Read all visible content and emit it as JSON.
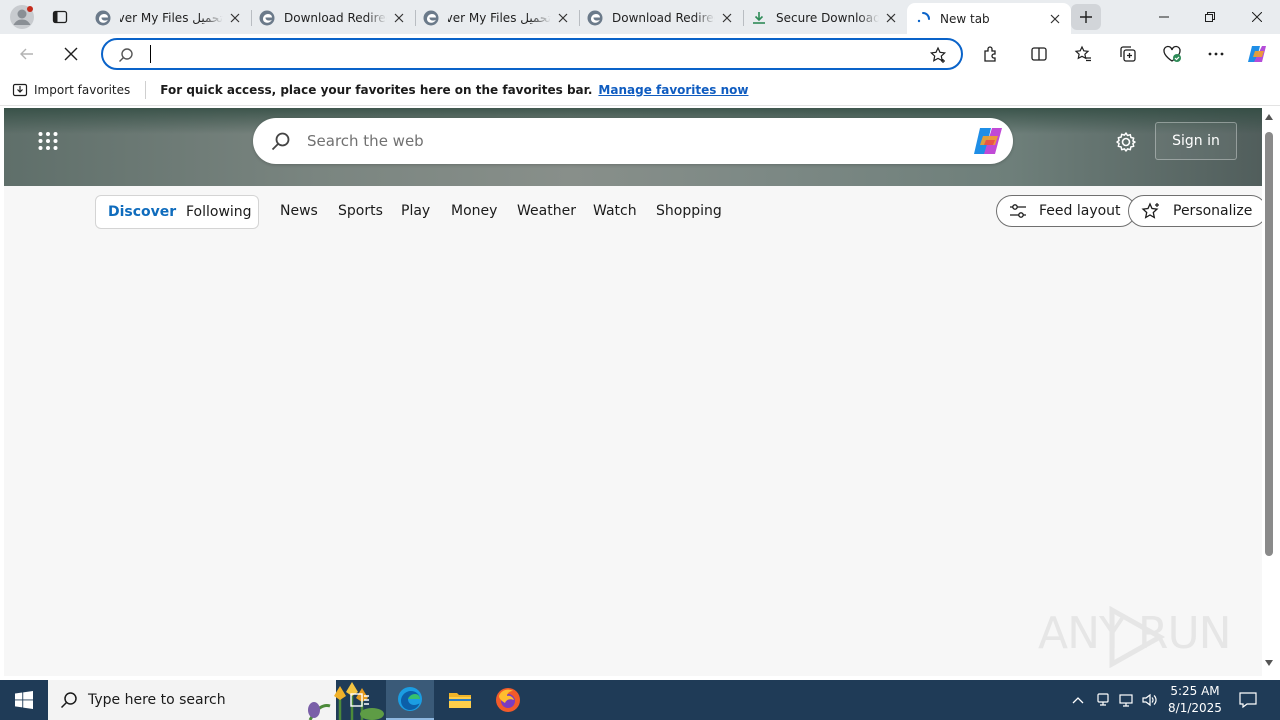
{
  "browser": {
    "tabs": [
      {
        "title": "تحميل Cover My Files",
        "favicon": "edge-page-icon",
        "active": false
      },
      {
        "title": "Download Redirecting",
        "favicon": "edge-page-icon",
        "active": false
      },
      {
        "title": "تحميل Cover My Files",
        "favicon": "edge-page-icon",
        "active": false
      },
      {
        "title": "Download Redirecting",
        "favicon": "edge-page-icon",
        "active": false
      },
      {
        "title": "Secure Download P",
        "favicon": "download-icon",
        "active": false
      },
      {
        "title": "New tab",
        "favicon": "loading-spinner-icon",
        "active": true
      }
    ],
    "address_value": "",
    "accent": "#0a63c9"
  },
  "favorites_bar": {
    "import_label": "Import favorites",
    "message": "For quick access, place your favorites here on the favorites bar.",
    "link": "Manage favorites now"
  },
  "newtab": {
    "search_placeholder": "Search the web",
    "sign_in": "Sign in",
    "nav": {
      "discover": "Discover",
      "following": "Following",
      "items": [
        "News",
        "Sports",
        "Play",
        "Money",
        "Weather",
        "Watch",
        "Shopping"
      ],
      "feed_layout": "Feed layout",
      "personalize": "Personalize"
    }
  },
  "watermark": "ANY RUN",
  "taskbar": {
    "search_placeholder": "Type here to search",
    "time": "5:25 AM",
    "date": "8/1/2025"
  }
}
